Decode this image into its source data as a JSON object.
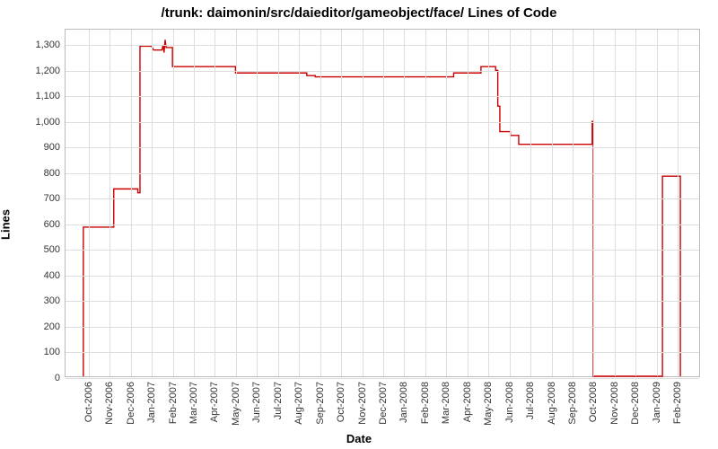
{
  "chart_data": {
    "type": "line",
    "title": "/trunk: daimonin/src/daieditor/gameobject/face/ Lines of Code",
    "xlabel": "Date",
    "ylabel": "Lines",
    "ylim": [
      0,
      1360
    ],
    "yticks": [
      0,
      100,
      200,
      300,
      400,
      500,
      600,
      700,
      800,
      900,
      1000,
      1100,
      1200,
      1300
    ],
    "xticks": [
      "Oct-2006",
      "Nov-2006",
      "Dec-2006",
      "Jan-2007",
      "Feb-2007",
      "Mar-2007",
      "Apr-2007",
      "May-2007",
      "Jun-2007",
      "Jul-2007",
      "Aug-2007",
      "Sep-2007",
      "Oct-2007",
      "Nov-2007",
      "Dec-2007",
      "Jan-2008",
      "Feb-2008",
      "Mar-2008",
      "Apr-2008",
      "May-2008",
      "Jun-2008",
      "Jul-2008",
      "Aug-2008",
      "Sep-2008",
      "Oct-2008",
      "Nov-2008",
      "Dec-2008",
      "Jan-2009",
      "Feb-2009"
    ],
    "series": [
      {
        "name": "Lines of Code",
        "color": "#cc0000",
        "points": [
          {
            "x": "Oct-2006",
            "xoff": 0.25,
            "y": 0
          },
          {
            "x": "Oct-2006",
            "xoff": 0.25,
            "y": 585
          },
          {
            "x": "Nov-2006",
            "xoff": 0.7,
            "y": 585
          },
          {
            "x": "Nov-2006",
            "xoff": 0.7,
            "y": 735
          },
          {
            "x": "Dec-2006",
            "xoff": 0.85,
            "y": 735
          },
          {
            "x": "Dec-2006",
            "xoff": 0.85,
            "y": 720
          },
          {
            "x": "Dec-2006",
            "xoff": 0.95,
            "y": 720
          },
          {
            "x": "Dec-2006",
            "xoff": 0.95,
            "y": 1295
          },
          {
            "x": "Jan-2007",
            "xoff": 0.5,
            "y": 1295
          },
          {
            "x": "Jan-2007",
            "xoff": 0.6,
            "y": 1280
          },
          {
            "x": "Feb-2007",
            "xoff": 0.0,
            "y": 1280
          },
          {
            "x": "Feb-2007",
            "xoff": 0.05,
            "y": 1300
          },
          {
            "x": "Feb-2007",
            "xoff": 0.1,
            "y": 1270
          },
          {
            "x": "Feb-2007",
            "xoff": 0.15,
            "y": 1320
          },
          {
            "x": "Feb-2007",
            "xoff": 0.2,
            "y": 1290
          },
          {
            "x": "Feb-2007",
            "xoff": 0.5,
            "y": 1290
          },
          {
            "x": "Feb-2007",
            "xoff": 0.5,
            "y": 1215
          },
          {
            "x": "May-2007",
            "xoff": 0.5,
            "y": 1215
          },
          {
            "x": "May-2007",
            "xoff": 0.5,
            "y": 1190
          },
          {
            "x": "Aug-2007",
            "xoff": 0.9,
            "y": 1190
          },
          {
            "x": "Aug-2007",
            "xoff": 0.9,
            "y": 1180
          },
          {
            "x": "Sep-2007",
            "xoff": 0.3,
            "y": 1180
          },
          {
            "x": "Sep-2007",
            "xoff": 0.3,
            "y": 1175
          },
          {
            "x": "Mar-2008",
            "xoff": 0.9,
            "y": 1175
          },
          {
            "x": "Mar-2008",
            "xoff": 0.9,
            "y": 1190
          },
          {
            "x": "May-2008",
            "xoff": 0.2,
            "y": 1190
          },
          {
            "x": "May-2008",
            "xoff": 0.2,
            "y": 1215
          },
          {
            "x": "May-2008",
            "xoff": 0.9,
            "y": 1215
          },
          {
            "x": "May-2008",
            "xoff": 0.9,
            "y": 1200
          },
          {
            "x": "Jun-2008",
            "xoff": 0.0,
            "y": 1200
          },
          {
            "x": "Jun-2008",
            "xoff": 0.0,
            "y": 1060
          },
          {
            "x": "Jun-2008",
            "xoff": 0.1,
            "y": 1060
          },
          {
            "x": "Jun-2008",
            "xoff": 0.1,
            "y": 960
          },
          {
            "x": "Jun-2008",
            "xoff": 0.6,
            "y": 960
          },
          {
            "x": "Jun-2008",
            "xoff": 0.6,
            "y": 945
          },
          {
            "x": "Jul-2008",
            "xoff": 0.0,
            "y": 945
          },
          {
            "x": "Jul-2008",
            "xoff": 0.0,
            "y": 910
          },
          {
            "x": "Oct-2008",
            "xoff": 0.5,
            "y": 910
          },
          {
            "x": "Oct-2008",
            "xoff": 0.5,
            "y": 1000
          },
          {
            "x": "Oct-2008",
            "xoff": 0.55,
            "y": 1000
          },
          {
            "x": "Oct-2008",
            "xoff": 0.55,
            "y": 0
          },
          {
            "x": "Jan-2009",
            "xoff": 0.85,
            "y": 0
          },
          {
            "x": "Jan-2009",
            "xoff": 0.85,
            "y": 785
          },
          {
            "x": "Feb-2009",
            "xoff": 0.7,
            "y": 785
          },
          {
            "x": "Feb-2009",
            "xoff": 0.7,
            "y": 0
          }
        ]
      }
    ]
  }
}
